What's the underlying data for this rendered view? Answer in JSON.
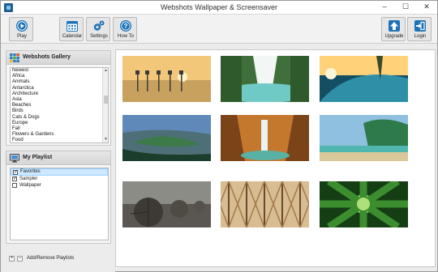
{
  "window": {
    "title": "Webshots Wallpaper & Screensaver",
    "controls": {
      "minimize": "–",
      "maximize": "☐",
      "close": "✕"
    }
  },
  "toolbar": {
    "play": "Play",
    "calendar": "Calendar",
    "settings": "Settings",
    "how_to": "How To",
    "upgrade": "Upgrade",
    "login": "Login",
    "accent": "#1e73b8"
  },
  "gallery": {
    "title": "Webshots Gallery",
    "items": [
      "Newest",
      "Africa",
      "Animals",
      "Antarctica",
      "Architecture",
      "Asia",
      "Beaches",
      "Birds",
      "Cats & Dogs",
      "Europe",
      "Fall",
      "Flowers & Gardens",
      "Food"
    ]
  },
  "playlist": {
    "title": "My Playlist",
    "items": [
      {
        "label": "Favorites",
        "checked": true,
        "selected": true
      },
      {
        "label": "Sampler",
        "checked": true,
        "selected": false
      },
      {
        "label": "Wallpaper",
        "checked": false,
        "selected": false
      }
    ],
    "add_symbol": "+",
    "remove_symbol": "–",
    "add_remove_label": "Add/Remove Playlists"
  },
  "thumbnails": [
    {
      "name": "stilt-fishermen-sunset-icon",
      "colors": [
        "#f3c77a",
        "#c9a15f",
        "#3b3a3a"
      ]
    },
    {
      "name": "turquoise-waterfall-icon",
      "colors": [
        "#3f6f3a",
        "#6fc9c4",
        "#f2f6f4"
      ]
    },
    {
      "name": "sunset-wave-icon",
      "colors": [
        "#ffd27a",
        "#2f8fa7",
        "#134e63"
      ]
    },
    {
      "name": "green-island-lake-icon",
      "colors": [
        "#5f89b8",
        "#3c7a4a",
        "#1b3d2b"
      ]
    },
    {
      "name": "canyon-waterfall-icon",
      "colors": [
        "#c4782e",
        "#7a4418",
        "#59b0a4"
      ]
    },
    {
      "name": "tropical-beach-cliff-icon",
      "colors": [
        "#8fc0e0",
        "#2f7a4a",
        "#d9c89a"
      ]
    },
    {
      "name": "boulders-beach-icon",
      "colors": [
        "#8c8c86",
        "#5a5752",
        "#3d3a36"
      ]
    },
    {
      "name": "vaulted-ceiling-icon",
      "colors": [
        "#d8bc92",
        "#a27a4e",
        "#6a4b2c"
      ]
    },
    {
      "name": "tropical-leaves-icon",
      "colors": [
        "#aee07a",
        "#3b8d2e",
        "#163e14"
      ]
    }
  ]
}
